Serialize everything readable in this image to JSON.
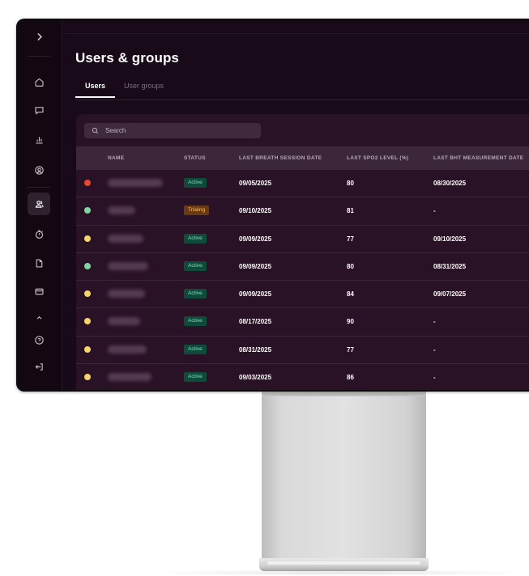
{
  "page": {
    "title": "Users & groups"
  },
  "sidebar": {
    "toggle_icon": "chevron-right-icon",
    "items": [
      {
        "name": "home",
        "icon": "home-icon"
      },
      {
        "name": "messages",
        "icon": "chat-icon"
      },
      {
        "name": "analytics",
        "icon": "bar-chart-icon"
      },
      {
        "name": "profile",
        "icon": "user-circle-icon"
      },
      {
        "name": "users-groups",
        "icon": "users-icon",
        "active": true
      },
      {
        "name": "timer",
        "icon": "stopwatch-icon"
      },
      {
        "name": "documents",
        "icon": "document-icon"
      },
      {
        "name": "billing",
        "icon": "credit-card-icon"
      },
      {
        "name": "help",
        "icon": "help-circle-icon"
      },
      {
        "name": "logout",
        "icon": "logout-icon"
      }
    ]
  },
  "tabs": [
    {
      "label": "Users",
      "active": true
    },
    {
      "label": "User groups",
      "active": false
    }
  ],
  "search": {
    "placeholder": "Search"
  },
  "table": {
    "columns": [
      "NAME",
      "STATUS",
      "LAST BREATH SESSION DATE",
      "LAST SPO2 LEVEL (%)",
      "LAST BHT MEASUREMENT DATE"
    ],
    "rows": [
      {
        "indicator": "#e8482c",
        "status": "Active",
        "breath": "09/05/2025",
        "spo2": "80",
        "bht": "08/30/2025"
      },
      {
        "indicator": "#7fd6a2",
        "status": "Trialing",
        "breath": "09/10/2025",
        "spo2": "81",
        "bht": "-"
      },
      {
        "indicator": "#f6d46a",
        "status": "Active",
        "breath": "09/09/2025",
        "spo2": "77",
        "bht": "09/10/2025"
      },
      {
        "indicator": "#7fd6a2",
        "status": "Active",
        "breath": "09/09/2025",
        "spo2": "80",
        "bht": "08/31/2025"
      },
      {
        "indicator": "#f6d46a",
        "status": "Active",
        "breath": "09/09/2025",
        "spo2": "84",
        "bht": "09/07/2025"
      },
      {
        "indicator": "#f6d46a",
        "status": "Active",
        "breath": "08/17/2025",
        "spo2": "90",
        "bht": "-"
      },
      {
        "indicator": "#f6d46a",
        "status": "Active",
        "breath": "08/31/2025",
        "spo2": "77",
        "bht": "-"
      },
      {
        "indicator": "#f6d46a",
        "status": "Active",
        "breath": "09/03/2025",
        "spo2": "86",
        "bht": "-"
      }
    ]
  },
  "colors": {
    "background": "#180a18",
    "panel": "#2a1226",
    "active_badge": "#0f4a3a",
    "trial_badge": "#6a3a12"
  }
}
